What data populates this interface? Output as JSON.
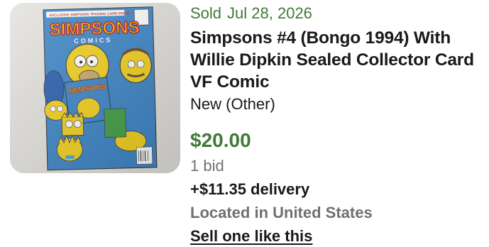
{
  "listing": {
    "sold_label": "Sold",
    "sold_date": "Jul 28, 2026",
    "title": "Simpsons #4 (Bongo 1994) With Willie Dipkin Sealed Collector Card VF Comic",
    "condition": "New (Other)",
    "price": "$20.00",
    "bids": "1 bid",
    "delivery": "+$11.35 delivery",
    "location": "Located in United States",
    "sell_link": "Sell one like this"
  },
  "thumbnail": {
    "logo_text": "SIMPSONS",
    "logo_subtext": "COMICS",
    "banner_text": "EXCLUSIVE SIMPSONS TRADING CARD INSIDE",
    "inner_logo_text": "SIMPSONS"
  },
  "colors": {
    "sold_green": "#3f7b34",
    "text_primary": "#191919",
    "text_secondary": "#707070"
  }
}
